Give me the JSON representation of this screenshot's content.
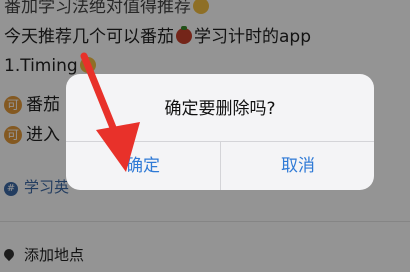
{
  "post": {
    "line0": "番加学习法绝对值得推荐",
    "line1": "今天推荐几个可以番茄",
    "line1_tail": "学习计时的app",
    "line2": "1.Timing",
    "line3_badge": "可",
    "line3": "番茄",
    "line4_badge": "可",
    "line4": "进入",
    "topic": "学习英",
    "topic_icon": "#",
    "location": "添加地点"
  },
  "dialog": {
    "title": "确定要删除吗?",
    "confirm_label": "确定",
    "cancel_label": "取消"
  },
  "annotation": {
    "arrow_color": "#e8312a"
  },
  "colors": {
    "link_blue": "#2f7ad6",
    "dialog_bg": "#f4f4f6"
  }
}
